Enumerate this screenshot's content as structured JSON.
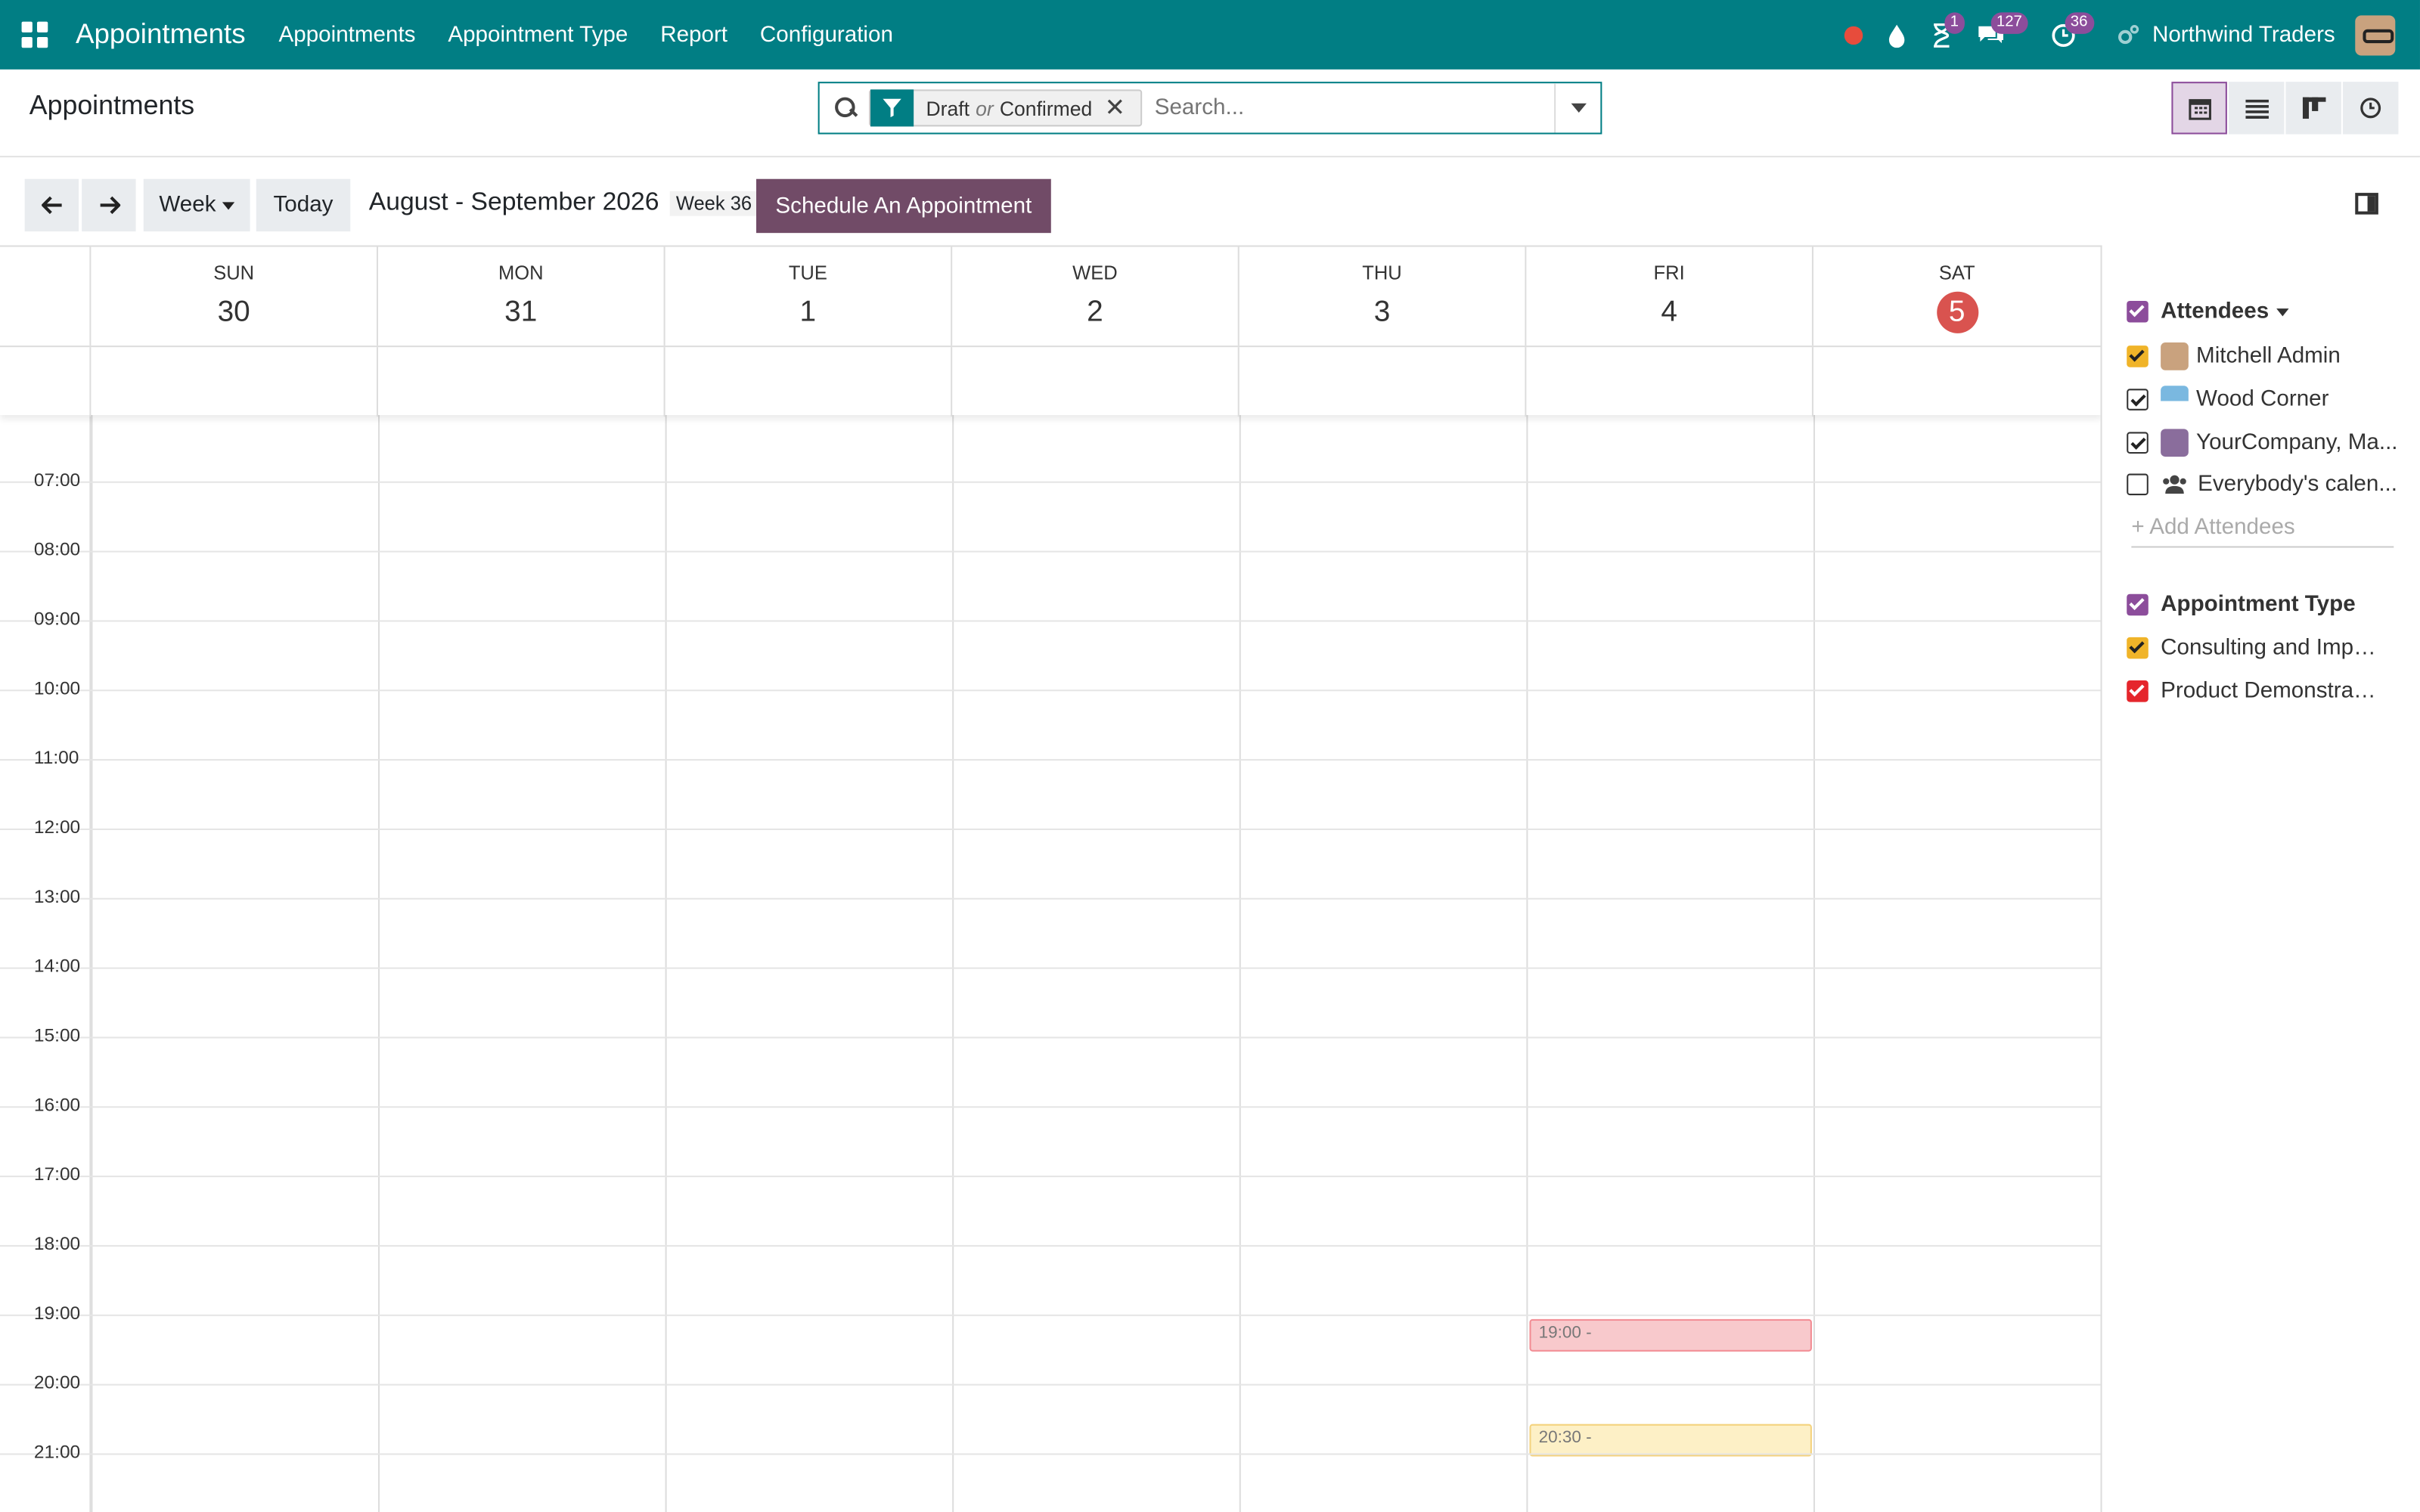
{
  "navbar": {
    "app_name": "Appointments",
    "menu": [
      "Appointments",
      "Appointment Type",
      "Report",
      "Configuration"
    ],
    "badges": {
      "activities": "1",
      "messages": "127",
      "timer": "36"
    },
    "company": "Northwind Traders"
  },
  "control_panel": {
    "title": "Appointments",
    "facet": {
      "first": "Draft",
      "or": "or",
      "second": "Confirmed"
    },
    "search_placeholder": "Search...",
    "views": [
      "calendar-icon",
      "list-icon",
      "kanban-icon",
      "activity-icon"
    ]
  },
  "toolbar": {
    "scale": "Week",
    "today": "Today",
    "range": "August - September 2026",
    "week": "Week 36",
    "schedule": "Schedule An Appointment"
  },
  "calendar": {
    "days": [
      {
        "name": "SUN",
        "num": "30"
      },
      {
        "name": "MON",
        "num": "31"
      },
      {
        "name": "TUE",
        "num": "1"
      },
      {
        "name": "WED",
        "num": "2"
      },
      {
        "name": "THU",
        "num": "3"
      },
      {
        "name": "FRI",
        "num": "4"
      },
      {
        "name": "SAT",
        "num": "5"
      }
    ],
    "hours": [
      "07:00",
      "08:00",
      "09:00",
      "10:00",
      "11:00",
      "12:00",
      "13:00",
      "14:00",
      "15:00",
      "16:00",
      "17:00",
      "18:00",
      "19:00",
      "20:00",
      "21:00"
    ],
    "events": [
      {
        "label": "19:00 -",
        "color": "#f8c9cc"
      },
      {
        "label": "20:30 -",
        "color": "#fdf0c6"
      }
    ]
  },
  "sidebar": {
    "attendees_title": "Attendees",
    "attendees": [
      {
        "name": "Mitchell Admin",
        "checked": true,
        "color": "#f0b429"
      },
      {
        "name": "Wood Corner",
        "checked": true,
        "color": "outline"
      },
      {
        "name": "YourCompany, Ma...",
        "checked": true,
        "color": "outline"
      },
      {
        "name": "Everybody's calen...",
        "checked": false,
        "color": "outline"
      }
    ],
    "add_attendees": "+ Add Attendees",
    "types_title": "Appointment Type",
    "types": [
      {
        "name": "Consulting and Imple...",
        "color": "#f0b429"
      },
      {
        "name": "Product Demonstrati...",
        "color": "#e5262c"
      }
    ]
  }
}
